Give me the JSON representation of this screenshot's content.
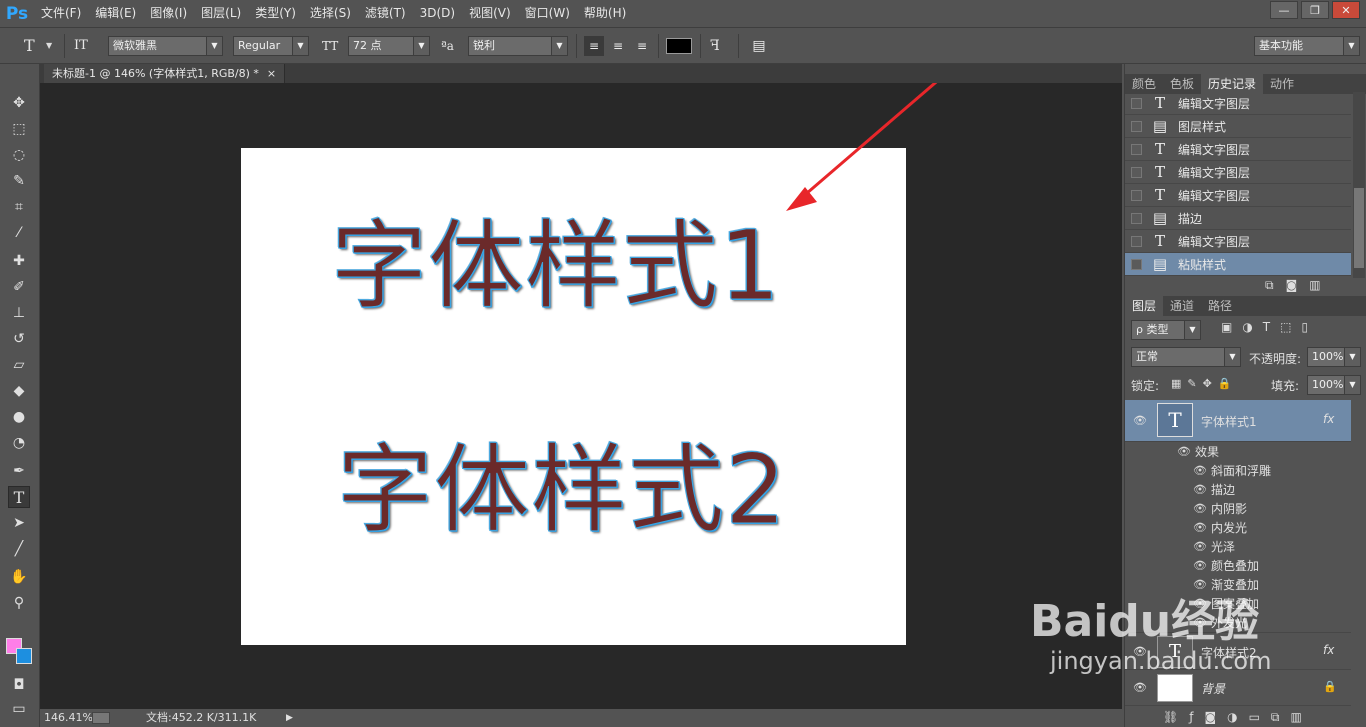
{
  "app": {
    "logo": "Ps"
  },
  "menu": [
    "文件(F)",
    "编辑(E)",
    "图像(I)",
    "图层(L)",
    "类型(Y)",
    "选择(S)",
    "滤镜(T)",
    "3D(D)",
    "视图(V)",
    "窗口(W)",
    "帮助(H)"
  ],
  "window_controls": [
    "—",
    "❐",
    "✕"
  ],
  "options": {
    "tool_glyph": "T",
    "orient_glyph": "IT",
    "font_family": "微软雅黑",
    "font_style": "Regular",
    "size_glyph": "TT",
    "font_size": "72 点",
    "aa_glyph": "ªa",
    "antialias": "锐利",
    "color": "#000000",
    "workspace": "基本功能"
  },
  "document": {
    "tab_title": "未标题-1 @ 146% (字体样式1, RGB/8) *",
    "tab_close": "×",
    "text1": "字体样式1",
    "text2": "字体样式2",
    "arrow_color": "#e8262a"
  },
  "status": {
    "zoom": "146.41%",
    "doc_size": "文档:452.2 K/311.1K"
  },
  "history_panel": {
    "tabs": [
      "颜色",
      "色板",
      "历史记录",
      "动作"
    ],
    "active_tab": "历史记录",
    "items": [
      {
        "icon": "text-layer-icon",
        "glyph": "T",
        "label": "编辑文字图层"
      },
      {
        "icon": "layer-style-icon",
        "glyph": "▤",
        "label": "图层样式"
      },
      {
        "icon": "text-layer-icon",
        "glyph": "T",
        "label": "编辑文字图层"
      },
      {
        "icon": "text-layer-icon",
        "glyph": "T",
        "label": "编辑文字图层"
      },
      {
        "icon": "text-layer-icon",
        "glyph": "T",
        "label": "编辑文字图层"
      },
      {
        "icon": "layer-style-icon",
        "glyph": "▤",
        "label": "描边"
      },
      {
        "icon": "text-layer-icon",
        "glyph": "T",
        "label": "编辑文字图层"
      },
      {
        "icon": "layer-style-icon",
        "glyph": "▤",
        "label": "粘贴样式"
      }
    ]
  },
  "layers_panel": {
    "tabs": [
      "图层",
      "通道",
      "路径"
    ],
    "filter": "ρ 类型",
    "blend_mode": "正常",
    "opacity_label": "不透明度:",
    "opacity": "100%",
    "lock_label": "锁定:",
    "fill_label": "填充:",
    "fill": "100%",
    "layers": [
      {
        "name": "字体样式1",
        "fx": "fx"
      },
      {
        "name": "字体样式2",
        "fx": "fx"
      },
      {
        "name": "背景"
      }
    ],
    "effects_label": "效果",
    "effects": [
      "斜面和浮雕",
      "描边",
      "内阴影",
      "内发光",
      "光泽",
      "颜色叠加",
      "渐变叠加",
      "图案叠加",
      "外发光"
    ]
  },
  "watermark": {
    "brand": "Baidu经验",
    "url": "jingyan.baidu.com"
  }
}
